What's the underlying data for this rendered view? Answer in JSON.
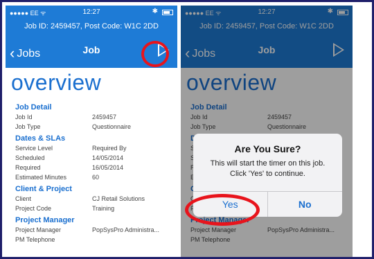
{
  "colors": {
    "nav": "#1e7bd6",
    "accent": "#1a6fcf",
    "highlight": "#e8141c"
  },
  "status": {
    "carrier": "●●●●● EE ᯤ",
    "time": "12:27",
    "bluetooth": "✱"
  },
  "job_header": "Job ID: 2459457, Post Code: W1C 2DD",
  "nav": {
    "back_label": "Jobs",
    "title": "Job",
    "start_icon": "play-icon"
  },
  "heading": "overview",
  "sections": [
    {
      "title": "Job Detail",
      "rows": [
        {
          "k": "Job Id",
          "v": "2459457"
        },
        {
          "k": "Job Type",
          "v": "Questionnaire"
        }
      ]
    },
    {
      "title": "Dates & SLAs",
      "rows": [
        {
          "k": "Service Level",
          "v": "Required By"
        },
        {
          "k": "Scheduled",
          "v": "14/05/2014"
        },
        {
          "k": "Required",
          "v": "16/05/2014"
        },
        {
          "k": "Estimated Minutes",
          "v": "60"
        }
      ]
    },
    {
      "title": "Client & Project",
      "rows": [
        {
          "k": "Client",
          "v": "CJ Retail Solutions"
        },
        {
          "k": "Project Code",
          "v": "Training"
        }
      ]
    },
    {
      "title": "Project Manager",
      "rows": [
        {
          "k": "Project Manager",
          "v": "PopSysPro Administra..."
        },
        {
          "k": "PM Telephone",
          "v": ""
        }
      ]
    }
  ],
  "dialog": {
    "title": "Are You Sure?",
    "message_line1": "This will start the timer on this job.",
    "message_line2": "Click 'Yes' to continue.",
    "yes": "Yes",
    "no": "No"
  }
}
